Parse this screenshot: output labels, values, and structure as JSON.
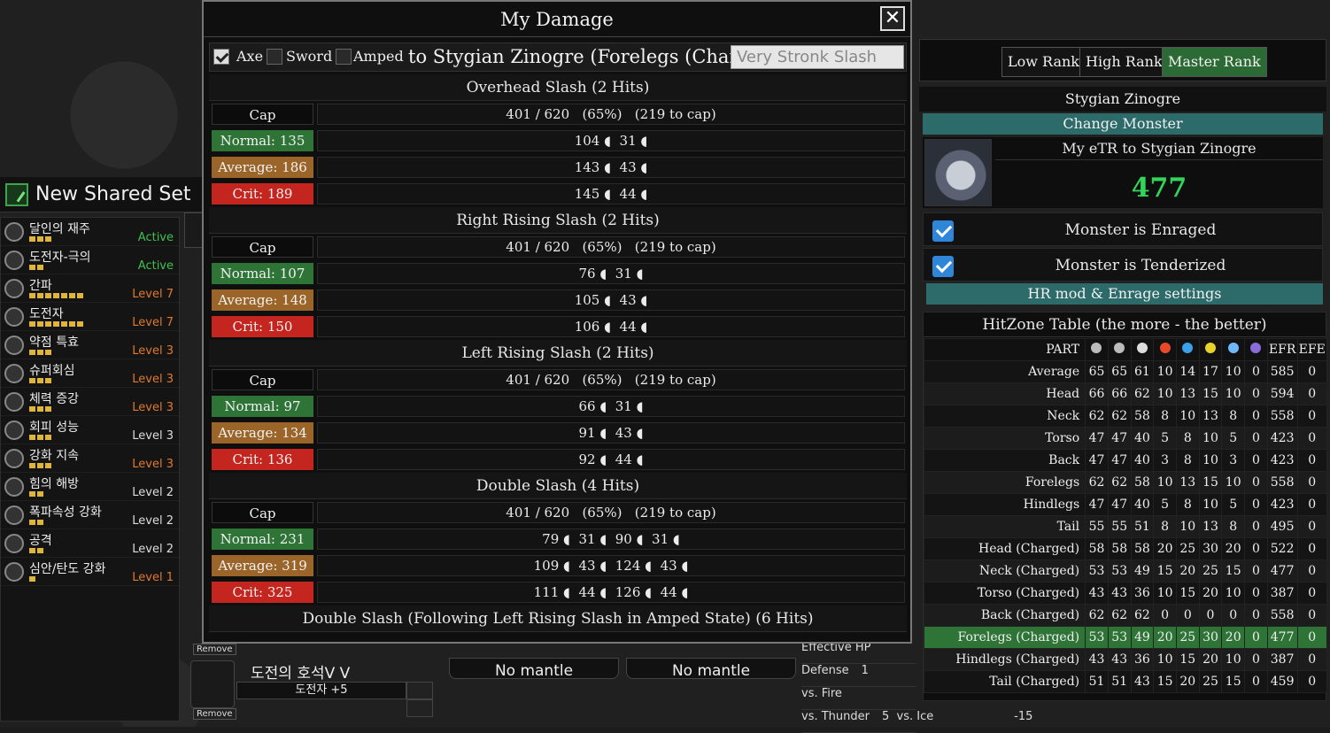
{
  "left": {
    "new_set": "New Shared Set",
    "skills": [
      {
        "name": "달인의 재주",
        "pips": 3,
        "level": "Active",
        "color": "#3ec14b"
      },
      {
        "name": "도전자-극의",
        "pips": 2,
        "level": "Active",
        "color": "#3ec14b"
      },
      {
        "name": "간파",
        "pips": 7,
        "level": "Level 7",
        "color": "#e07a2a"
      },
      {
        "name": "도전자",
        "pips": 7,
        "level": "Level 7",
        "color": "#e07a2a"
      },
      {
        "name": "약점 특효",
        "pips": 3,
        "level": "Level 3",
        "color": "#e07a2a"
      },
      {
        "name": "슈퍼회심",
        "pips": 3,
        "level": "Level 3",
        "color": "#e07a2a"
      },
      {
        "name": "체력 증강",
        "pips": 3,
        "level": "Level 3",
        "color": "#e07a2a"
      },
      {
        "name": "회피 성능",
        "pips": 3,
        "level": "Level 3",
        "color": "#dddddd"
      },
      {
        "name": "강화 지속",
        "pips": 3,
        "level": "Level 3",
        "color": "#e07a2a"
      },
      {
        "name": "힘의 해방",
        "pips": 2,
        "level": "Level 2",
        "color": "#dddddd"
      },
      {
        "name": "폭파속성 강화",
        "pips": 2,
        "level": "Level 2",
        "color": "#dddddd"
      },
      {
        "name": "공격",
        "pips": 2,
        "level": "Level 2",
        "color": "#dddddd"
      },
      {
        "name": "심안/탄도 강화",
        "pips": 1,
        "level": "Level 1",
        "color": "#e07a2a"
      }
    ]
  },
  "bottom": {
    "remove_1": "Remove",
    "remove_2": "Remove",
    "deco_name": "도전의 호석V V",
    "deco_skill": "도전자 +5",
    "mantle_1": "No mantle",
    "mantle_2": "No mantle",
    "stat_rows": [
      {
        "label": "Effective HP",
        "value": ""
      },
      {
        "label": "Defense",
        "value": "1"
      },
      {
        "label": "vs. Fire",
        "value": ""
      },
      {
        "label": "vs. Thunder",
        "value": "5  vs. Ice                      -15"
      }
    ]
  },
  "dialog": {
    "title": "My Damage",
    "close": "✕",
    "opt_axe": "Axe",
    "opt_sword": "Sword",
    "opt_amped": "Amped",
    "target": "to Stygian Zinogre (Forelegs (Charged))",
    "preset": "Very Stronk Slash",
    "moves": [
      {
        "name": "Overhead Slash (2 Hits)",
        "cap": "401 / 620   (65%)   (219 to cap)",
        "normal": "Normal: 135",
        "normal_v": "104 ◖  31 ◖",
        "avg": "Average: 186",
        "avg_v": "143 ◖  43 ◖",
        "crit": "Crit: 189",
        "crit_v": "145 ◖  44 ◖"
      },
      {
        "name": "Right Rising Slash (2 Hits)",
        "cap": "401 / 620   (65%)   (219 to cap)",
        "normal": "Normal: 107",
        "normal_v": "76 ◖  31 ◖",
        "avg": "Average: 148",
        "avg_v": "105 ◖  43 ◖",
        "crit": "Crit: 150",
        "crit_v": "106 ◖  44 ◖"
      },
      {
        "name": "Left Rising Slash (2 Hits)",
        "cap": "401 / 620   (65%)   (219 to cap)",
        "normal": "Normal: 97",
        "normal_v": "66 ◖  31 ◖",
        "avg": "Average: 134",
        "avg_v": "91 ◖  43 ◖",
        "crit": "Crit: 136",
        "crit_v": "92 ◖  44 ◖"
      },
      {
        "name": "Double Slash (4 Hits)",
        "cap": "401 / 620   (65%)   (219 to cap)",
        "normal": "Normal: 231",
        "normal_v": "79 ◖  31 ◖  90 ◖  31 ◖",
        "avg": "Average: 319",
        "avg_v": "109 ◖  43 ◖  124 ◖  43 ◖",
        "crit": "Crit: 325",
        "crit_v": "111 ◖  44 ◖  126 ◖  44 ◖"
      }
    ],
    "last_move": "Double Slash (Following Left Rising Slash in Amped State) (6 Hits)",
    "cap_label": "Cap"
  },
  "right": {
    "ranks": [
      "Low Rank",
      "High Rank",
      "Master Rank"
    ],
    "monster": "Stygian Zinogre",
    "change_monster": "Change Monster",
    "etr_label": "My eTR to Stygian Zinogre",
    "etr_value": "477",
    "enraged": "Monster is Enraged",
    "tenderized": "Monster is Tenderized",
    "hr_mod": "HR mod & Enrage settings",
    "hz_title": "HitZone Table (the more - the better)",
    "hz_part_header": "PART",
    "hz_efr": "EFR",
    "hz_efe": "EFE",
    "hz_icon_colors": [
      "#bbbbbb",
      "#bbbbbb",
      "#dddddd",
      "#e8492a",
      "#3aa0e8",
      "#e8d22a",
      "#6fb8ff",
      "#8a6cd8"
    ],
    "hz_rows": [
      [
        "Average",
        "65",
        "65",
        "61",
        "10",
        "14",
        "17",
        "10",
        "0",
        "585",
        "0"
      ],
      [
        "Head",
        "66",
        "66",
        "62",
        "10",
        "13",
        "15",
        "10",
        "0",
        "594",
        "0"
      ],
      [
        "Neck",
        "62",
        "62",
        "58",
        "8",
        "10",
        "13",
        "8",
        "0",
        "558",
        "0"
      ],
      [
        "Torso",
        "47",
        "47",
        "40",
        "5",
        "8",
        "10",
        "5",
        "0",
        "423",
        "0"
      ],
      [
        "Back",
        "47",
        "47",
        "40",
        "3",
        "8",
        "10",
        "3",
        "0",
        "423",
        "0"
      ],
      [
        "Forelegs",
        "62",
        "62",
        "58",
        "10",
        "13",
        "15",
        "10",
        "0",
        "558",
        "0"
      ],
      [
        "Hindlegs",
        "47",
        "47",
        "40",
        "5",
        "8",
        "10",
        "5",
        "0",
        "423",
        "0"
      ],
      [
        "Tail",
        "55",
        "55",
        "51",
        "8",
        "10",
        "13",
        "8",
        "0",
        "495",
        "0"
      ],
      [
        "Head (Charged)",
        "58",
        "58",
        "58",
        "20",
        "25",
        "30",
        "20",
        "0",
        "522",
        "0"
      ],
      [
        "Neck (Charged)",
        "53",
        "53",
        "49",
        "15",
        "20",
        "25",
        "15",
        "0",
        "477",
        "0"
      ],
      [
        "Torso (Charged)",
        "43",
        "43",
        "36",
        "10",
        "15",
        "20",
        "10",
        "0",
        "387",
        "0"
      ],
      [
        "Back (Charged)",
        "62",
        "62",
        "62",
        "0",
        "0",
        "0",
        "0",
        "0",
        "558",
        "0"
      ],
      [
        "Forelegs (Charged)",
        "53",
        "53",
        "49",
        "20",
        "25",
        "30",
        "20",
        "0",
        "477",
        "0"
      ],
      [
        "Hindlegs (Charged)",
        "43",
        "43",
        "36",
        "10",
        "15",
        "20",
        "10",
        "0",
        "387",
        "0"
      ],
      [
        "Tail (Charged)",
        "51",
        "51",
        "43",
        "15",
        "20",
        "25",
        "15",
        "0",
        "459",
        "0"
      ]
    ],
    "hz_highlight_row": 12
  }
}
